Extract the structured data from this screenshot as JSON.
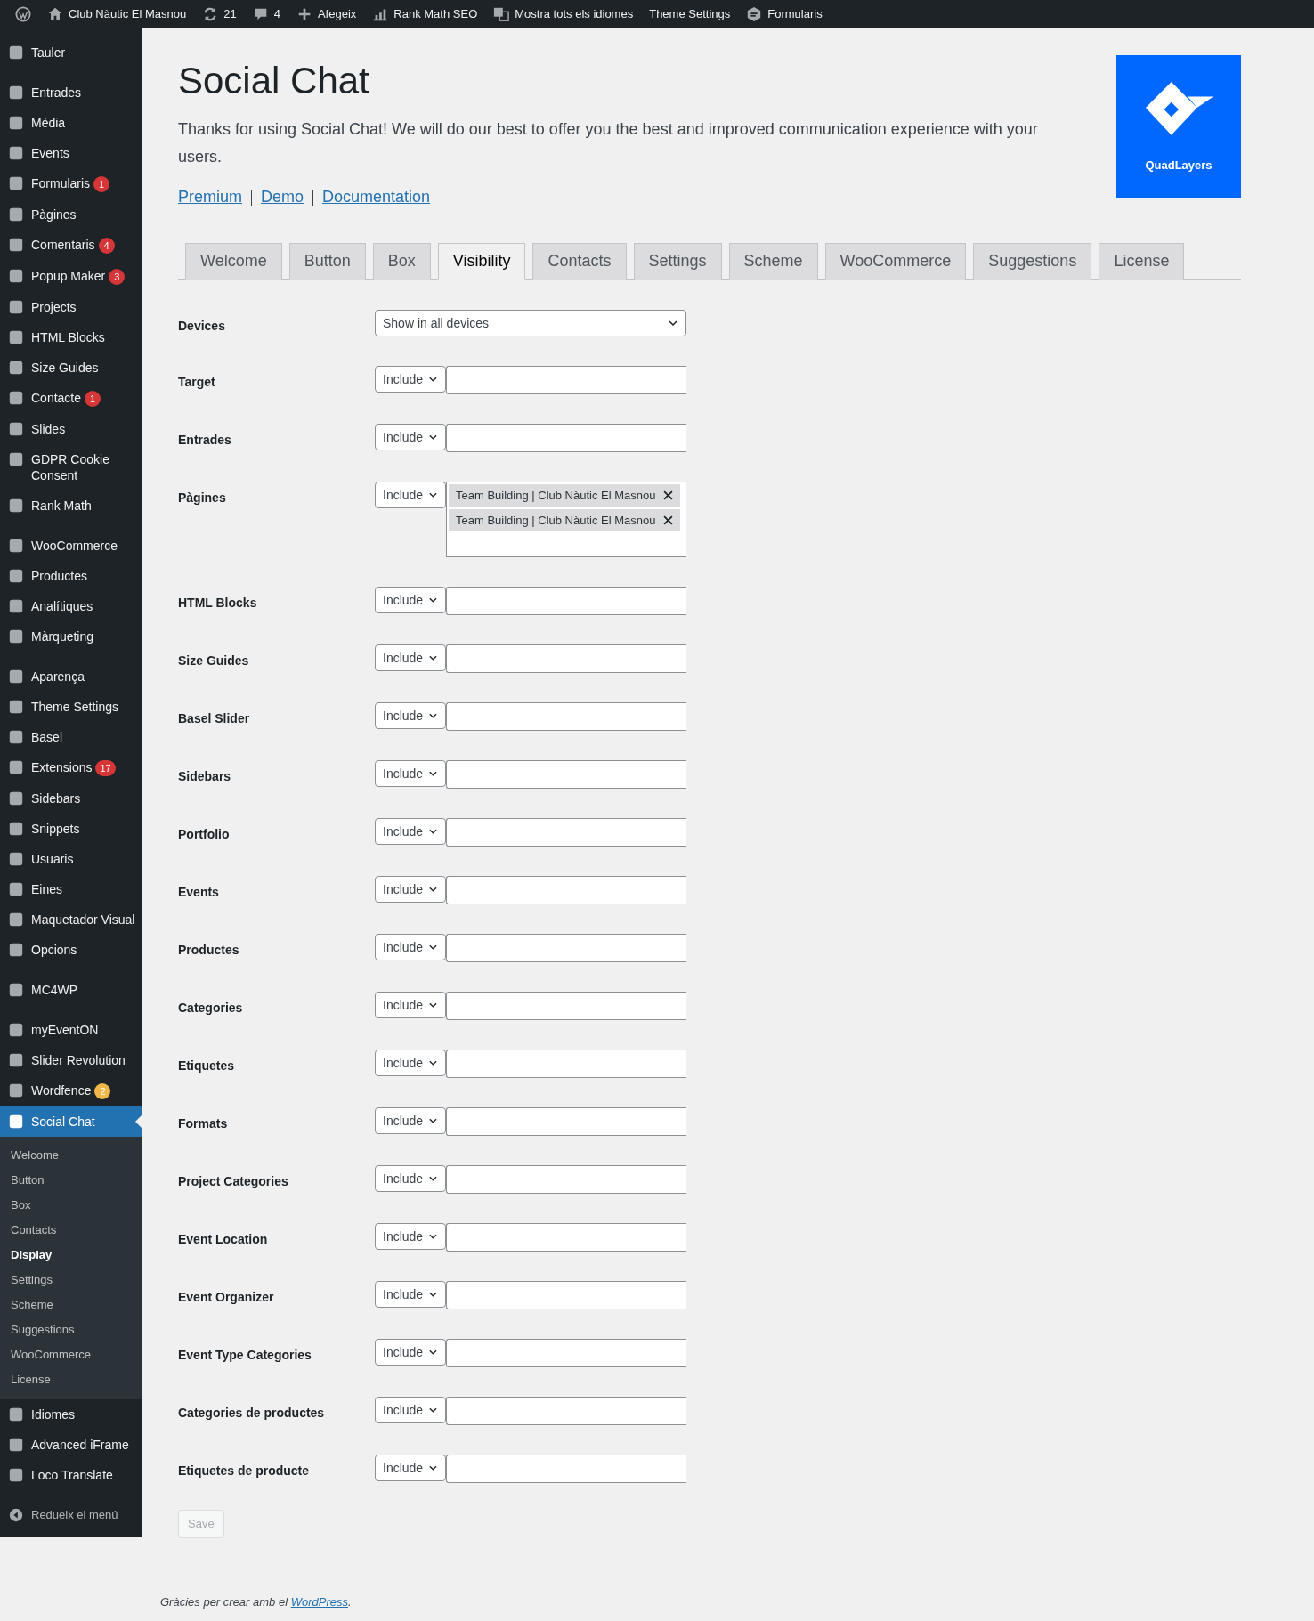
{
  "admin_bar": [
    {
      "kind": "wp"
    },
    {
      "kind": "home",
      "text": "Club Nàutic El Masnou"
    },
    {
      "kind": "updates",
      "text": "21"
    },
    {
      "kind": "comments",
      "text": "4"
    },
    {
      "kind": "new",
      "text": "Afegeix"
    },
    {
      "kind": "chart",
      "text": "Rank Math SEO"
    },
    {
      "kind": "language",
      "text": "Mostra tots els idiomes"
    },
    {
      "kind": "plain",
      "text": "Theme Settings"
    },
    {
      "kind": "form",
      "text": "Formularis"
    }
  ],
  "sidebar": {
    "groups": [
      [
        {
          "label": "Tauler",
          "selected": false
        }
      ],
      [
        {
          "label": "Entrades",
          "selected": false
        },
        {
          "label": "Mèdia",
          "selected": false
        },
        {
          "label": "Events",
          "selected": false
        },
        {
          "label": "Formularis",
          "selected": false,
          "badge": {
            "text": "1",
            "color": "#d63638"
          }
        },
        {
          "label": "Pàgines",
          "selected": false
        },
        {
          "label": "Comentaris",
          "selected": false,
          "badge": {
            "text": "4",
            "color": "#d63638"
          }
        },
        {
          "label": "Popup Maker",
          "selected": false,
          "badge": {
            "text": "3",
            "color": "#d63638"
          }
        },
        {
          "label": "Projects",
          "selected": false
        },
        {
          "label": "HTML Blocks",
          "selected": false
        },
        {
          "label": "Size Guides",
          "selected": false
        },
        {
          "label": "Contacte",
          "selected": false,
          "badge": {
            "text": "1",
            "color": "#d63638"
          }
        },
        {
          "label": "Slides",
          "selected": false
        },
        {
          "label": "GDPR Cookie Consent",
          "selected": false
        },
        {
          "label": "Rank Math",
          "selected": false
        }
      ],
      [
        {
          "label": "WooCommerce",
          "selected": false
        },
        {
          "label": "Productes",
          "selected": false
        },
        {
          "label": "Analítiques",
          "selected": false
        },
        {
          "label": "Màrqueting",
          "selected": false
        }
      ],
      [
        {
          "label": "Aparença",
          "selected": false
        },
        {
          "label": "Theme Settings",
          "selected": false
        },
        {
          "label": "Basel",
          "selected": false
        },
        {
          "label": "Extensions",
          "selected": false,
          "badge": {
            "text": "17",
            "color": "#d63638"
          }
        },
        {
          "label": "Sidebars",
          "selected": false
        },
        {
          "label": "Snippets",
          "selected": false
        },
        {
          "label": "Usuaris",
          "selected": false
        },
        {
          "label": "Eines",
          "selected": false
        },
        {
          "label": "Maquetador Visual",
          "selected": false
        },
        {
          "label": "Opcions",
          "selected": false
        }
      ],
      [
        {
          "label": "MC4WP",
          "selected": false
        }
      ],
      [
        {
          "label": "myEventON",
          "selected": false
        },
        {
          "label": "Slider Revolution",
          "selected": false
        },
        {
          "label": "Wordfence",
          "selected": false,
          "badge": {
            "text": "2",
            "color": "#f0b849"
          }
        },
        {
          "label": "Social Chat",
          "selected": true,
          "submenu": [
            {
              "label": "Welcome",
              "selected": false
            },
            {
              "label": "Button",
              "selected": false
            },
            {
              "label": "Box",
              "selected": false
            },
            {
              "label": "Contacts",
              "selected": false
            },
            {
              "label": "Display",
              "selected": true
            },
            {
              "label": "Settings",
              "selected": false
            },
            {
              "label": "Scheme",
              "selected": false
            },
            {
              "label": "Suggestions",
              "selected": false
            },
            {
              "label": "WooCommerce",
              "selected": false
            },
            {
              "label": "License",
              "selected": false
            }
          ]
        },
        {
          "label": "Idiomes",
          "selected": false
        },
        {
          "label": "Advanced iFrame",
          "selected": false
        },
        {
          "label": "Loco Translate",
          "selected": false
        }
      ]
    ],
    "collapse": "Redueix el menú"
  },
  "page": {
    "title": "Social Chat",
    "intro": "Thanks for using Social Chat! We will do our best to offer you the best and improved communication experience with your users.",
    "links": [
      "Premium",
      "Demo",
      "Documentation"
    ],
    "logo": "QuadLayers"
  },
  "tabs": [
    {
      "label": "Welcome",
      "selected": false
    },
    {
      "label": "Button",
      "selected": false
    },
    {
      "label": "Box",
      "selected": false
    },
    {
      "label": "Visibility",
      "selected": true
    },
    {
      "label": "Contacts",
      "selected": false
    },
    {
      "label": "Settings",
      "selected": false
    },
    {
      "label": "Scheme",
      "selected": false
    },
    {
      "label": "WooCommerce",
      "selected": false
    },
    {
      "label": "Suggestions",
      "selected": false
    },
    {
      "label": "License",
      "selected": false
    }
  ],
  "fields": [
    {
      "label": "Devices",
      "kind": "select",
      "value": "Show in all devices"
    },
    {
      "label": "Target",
      "kind": "filter",
      "mode": "Include"
    },
    {
      "label": "Entrades",
      "kind": "filter",
      "mode": "Include"
    },
    {
      "label": "Pàgines",
      "kind": "filter",
      "mode": "Include",
      "tags": [
        "Team Building | Club Nàutic El Masnou",
        "Team Building | Club Nàutic El Masnou"
      ]
    },
    {
      "label": "HTML Blocks",
      "kind": "filter",
      "mode": "Include"
    },
    {
      "label": "Size Guides",
      "kind": "filter",
      "mode": "Include"
    },
    {
      "label": "Basel Slider",
      "kind": "filter",
      "mode": "Include"
    },
    {
      "label": "Sidebars",
      "kind": "filter",
      "mode": "Include"
    },
    {
      "label": "Portfolio",
      "kind": "filter",
      "mode": "Include"
    },
    {
      "label": "Events",
      "kind": "filter",
      "mode": "Include"
    },
    {
      "label": "Productes",
      "kind": "filter",
      "mode": "Include"
    },
    {
      "label": "Categories",
      "kind": "filter",
      "mode": "Include"
    },
    {
      "label": "Etiquetes",
      "kind": "filter",
      "mode": "Include"
    },
    {
      "label": "Formats",
      "kind": "filter",
      "mode": "Include"
    },
    {
      "label": "Project Categories",
      "kind": "filter",
      "mode": "Include"
    },
    {
      "label": "Event Location",
      "kind": "filter",
      "mode": "Include"
    },
    {
      "label": "Event Organizer",
      "kind": "filter",
      "mode": "Include"
    },
    {
      "label": "Event Type Categories",
      "kind": "filter",
      "mode": "Include"
    },
    {
      "label": "Categories de productes",
      "kind": "filter",
      "mode": "Include"
    },
    {
      "label": "Etiquetes de producte",
      "kind": "filter",
      "mode": "Include"
    }
  ],
  "save": {
    "label": "Save",
    "disabled": true
  },
  "footer": {
    "text": "Gràcies per crear amb el ",
    "link": "WordPress",
    "after": "."
  }
}
